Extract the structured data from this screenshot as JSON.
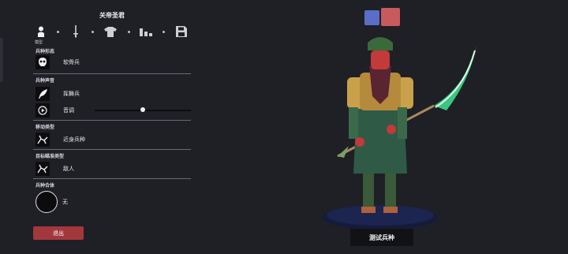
{
  "unit_name": "关帝圣君",
  "tabs": [
    {
      "icon": "person-icon",
      "label": "模型",
      "active": true
    },
    {
      "icon": "sword-icon",
      "label": ""
    },
    {
      "icon": "shirt-icon",
      "label": ""
    },
    {
      "icon": "stats-icon",
      "label": ""
    },
    {
      "icon": "save-icon",
      "label": ""
    }
  ],
  "sections": {
    "unit_base": {
      "heading": "兵种形态",
      "value": "软骨兵",
      "icon": "skull-mask-icon"
    },
    "unit_voice": {
      "heading": "兵种声音",
      "value": "挥舞兵",
      "icon": "feather-icon",
      "pitch_label": "音调",
      "pitch_icon": "play-icon",
      "pitch_value": 0.5
    },
    "movement": {
      "heading": "移动类型",
      "value": "近身兵种",
      "icon": "melee-icon"
    },
    "targeting": {
      "heading": "目标瞄准类型",
      "value": "敌人",
      "icon": "target-enemy-icon"
    },
    "fusion": {
      "heading": "兵种合体",
      "value": "无",
      "icon": "empty-circle-icon"
    }
  },
  "exit_label": "退出",
  "test_label": "测试兵种",
  "team_colors": [
    "#5a6ec8",
    "#c85a5e"
  ]
}
